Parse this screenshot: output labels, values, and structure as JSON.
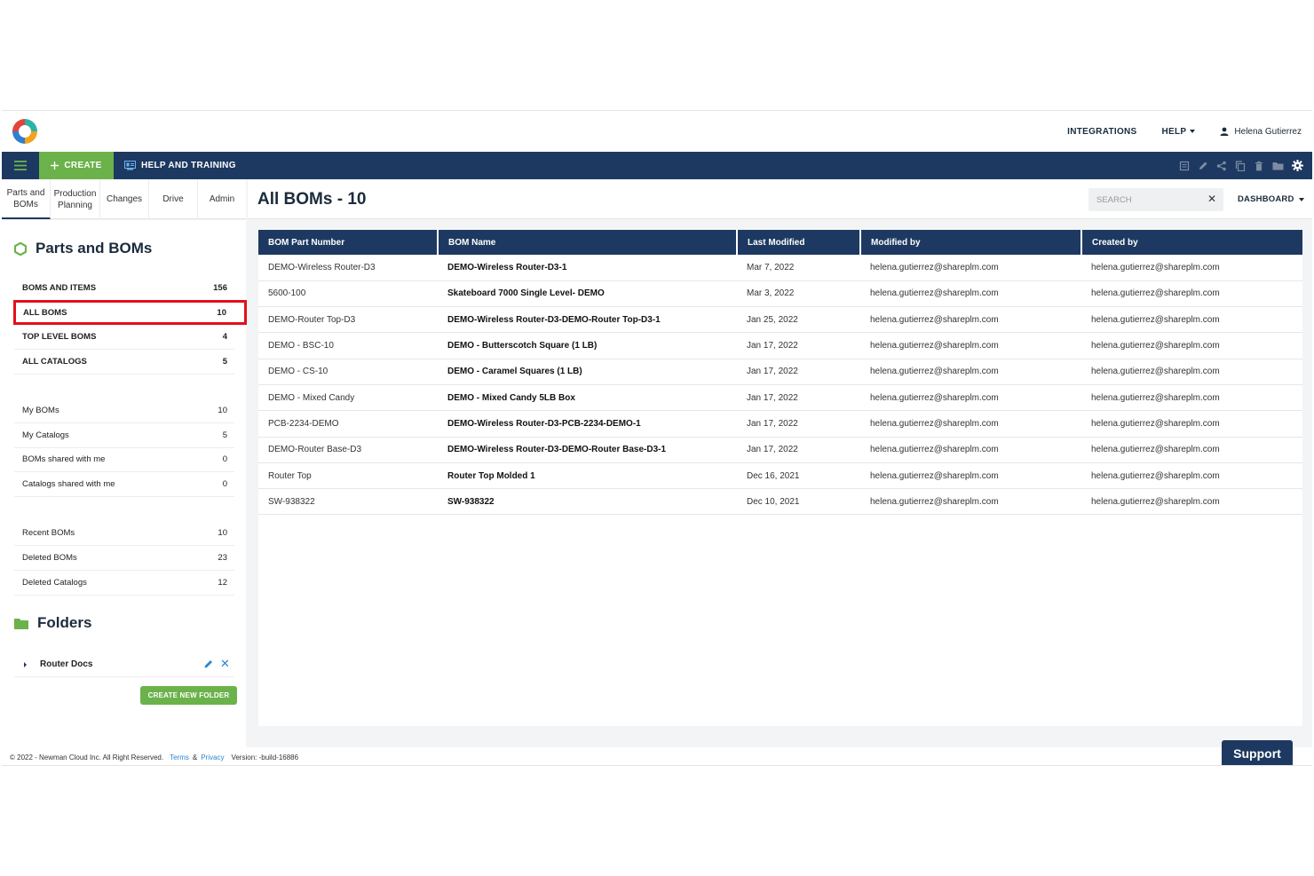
{
  "topbar": {
    "integrations": "INTEGRATIONS",
    "help": "HELP",
    "user_name": "Helena Gutierrez"
  },
  "navbar": {
    "create_label": "CREATE",
    "help_training_label": "HELP AND TRAINING",
    "toolbar_icons": [
      "document-icon",
      "pencil-icon",
      "share-icon",
      "copy-icon",
      "trash-icon",
      "folder-icon",
      "gear-icon"
    ]
  },
  "tabs": [
    {
      "label_line1": "Parts and",
      "label_line2": "BOMs"
    },
    {
      "label_line1": "Production",
      "label_line2": "Planning"
    },
    {
      "label_line1": "Changes",
      "label_line2": ""
    },
    {
      "label_line1": "Drive",
      "label_line2": ""
    },
    {
      "label_line1": "Admin",
      "label_line2": ""
    }
  ],
  "sidebar": {
    "title": "Parts and BOMs",
    "primary": [
      {
        "label": "BOMS AND ITEMS",
        "count": "156"
      },
      {
        "label": "ALL BOMS",
        "count": "10"
      },
      {
        "label": "TOP LEVEL BOMS",
        "count": "4"
      },
      {
        "label": "ALL CATALOGS",
        "count": "5"
      }
    ],
    "mine": [
      {
        "label": "My BOMs",
        "count": "10"
      },
      {
        "label": "My Catalogs",
        "count": "5"
      },
      {
        "label": "BOMs shared with me",
        "count": "0"
      },
      {
        "label": "Catalogs shared with me",
        "count": "0"
      }
    ],
    "history": [
      {
        "label": "Recent BOMs",
        "count": "10"
      },
      {
        "label": "Deleted BOMs",
        "count": "23"
      },
      {
        "label": "Deleted Catalogs",
        "count": "12"
      }
    ],
    "folders_title": "Folders",
    "folder_name": "Router Docs",
    "create_folder_label": "CREATE NEW FOLDER"
  },
  "main": {
    "title": "All BOMs - 10",
    "search_placeholder": "SEARCH",
    "dashboard_label": "DASHBOARD",
    "columns": [
      "BOM Part Number",
      "BOM Name",
      "Last Modified",
      "Modified by",
      "Created by"
    ],
    "rows": [
      [
        "DEMO-Wireless Router-D3",
        "DEMO-Wireless Router-D3-1",
        "Mar 7, 2022",
        "helena.gutierrez@shareplm.com",
        "helena.gutierrez@shareplm.com"
      ],
      [
        "5600-100",
        "Skateboard 7000 Single Level- DEMO",
        "Mar 3, 2022",
        "helena.gutierrez@shareplm.com",
        "helena.gutierrez@shareplm.com"
      ],
      [
        "DEMO-Router Top-D3",
        "DEMO-Wireless Router-D3-DEMO-Router Top-D3-1",
        "Jan 25, 2022",
        "helena.gutierrez@shareplm.com",
        "helena.gutierrez@shareplm.com"
      ],
      [
        "DEMO - BSC-10",
        "DEMO - Butterscotch Square (1 LB)",
        "Jan 17, 2022",
        "helena.gutierrez@shareplm.com",
        "helena.gutierrez@shareplm.com"
      ],
      [
        "DEMO - CS-10",
        "DEMO - Caramel Squares (1 LB)",
        "Jan 17, 2022",
        "helena.gutierrez@shareplm.com",
        "helena.gutierrez@shareplm.com"
      ],
      [
        "DEMO - Mixed Candy",
        "DEMO - Mixed Candy 5LB Box",
        "Jan 17, 2022",
        "helena.gutierrez@shareplm.com",
        "helena.gutierrez@shareplm.com"
      ],
      [
        "PCB-2234-DEMO",
        "DEMO-Wireless Router-D3-PCB-2234-DEMO-1",
        "Jan 17, 2022",
        "helena.gutierrez@shareplm.com",
        "helena.gutierrez@shareplm.com"
      ],
      [
        "DEMO-Router Base-D3",
        "DEMO-Wireless Router-D3-DEMO-Router Base-D3-1",
        "Jan 17, 2022",
        "helena.gutierrez@shareplm.com",
        "helena.gutierrez@shareplm.com"
      ],
      [
        "Router Top",
        "Router Top Molded 1",
        "Dec 16, 2021",
        "helena.gutierrez@shareplm.com",
        "helena.gutierrez@shareplm.com"
      ],
      [
        "SW-938322",
        "SW-938322",
        "Dec 10, 2021",
        "helena.gutierrez@shareplm.com",
        "helena.gutierrez@shareplm.com"
      ]
    ]
  },
  "footer": {
    "copyright": "© 2022 - Newman Cloud Inc. All Right Reserved.",
    "terms": "Terms",
    "amp": "&",
    "privacy": "Privacy",
    "version": "Version: -build-16886",
    "support_label": "Support"
  },
  "colors": {
    "navy": "#1d3961",
    "green": "#6bb24a",
    "highlight_red": "#e3101a",
    "link_blue": "#2a86d1"
  }
}
